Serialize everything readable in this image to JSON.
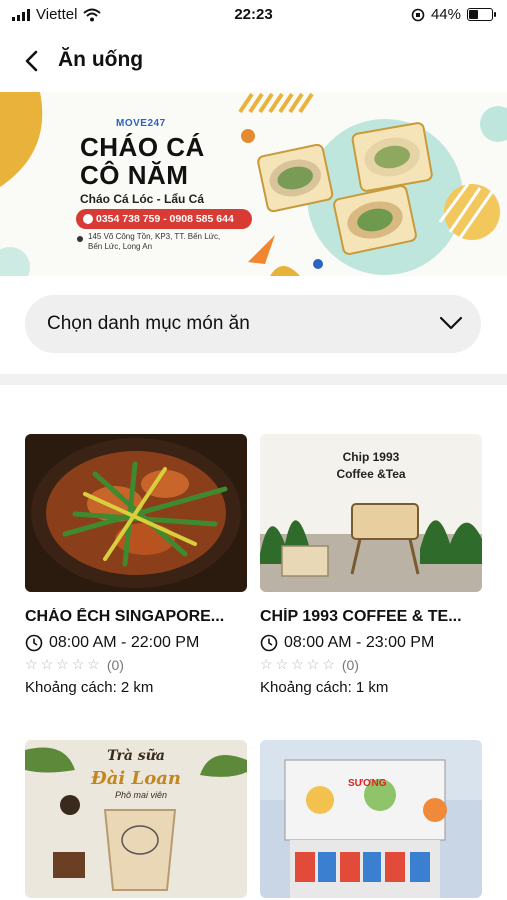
{
  "status": {
    "carrier": "Viettel",
    "time": "22:23",
    "battery": "44%",
    "battery_level": 0.44
  },
  "header": {
    "title": "Ăn uống"
  },
  "banner": {
    "brand": "MOVE247",
    "name_line1": "CHÁO CÁ",
    "name_line2": "CÔ NĂM",
    "subtitle": "Cháo Cá Lóc - Lẩu Cá",
    "phone": "0354 738 759 - 0908 585 644",
    "address_line1": "145 Võ Công Tồn, KP3, TT. Bến Lức,",
    "address_line2": "Bến Lức, Long An"
  },
  "category_dropdown": {
    "label": "Chọn danh mục món ăn"
  },
  "listings": [
    {
      "name": "CHÁO ẾCH SINGAPORE...",
      "hours": "08:00 AM - 22:00 PM",
      "rating_count": "(0)",
      "stars": 0,
      "distance": "Khoảng cách: 2 km"
    },
    {
      "name": "CHÍP 1993 COFFEE & TE...",
      "hours": "08:00 AM - 23:00 PM",
      "rating_count": "(0)",
      "stars": 0,
      "distance": "Khoảng cách: 1 km",
      "image_text_1": "Chip 1993",
      "image_text_2": "Coffee &Tea"
    },
    {
      "image_text_1": "Trà sữa",
      "image_text_2": "Đài Loan",
      "image_text_3": "Phô mai viên"
    },
    {
      "image_text_1": "SƯƠNG"
    }
  ]
}
